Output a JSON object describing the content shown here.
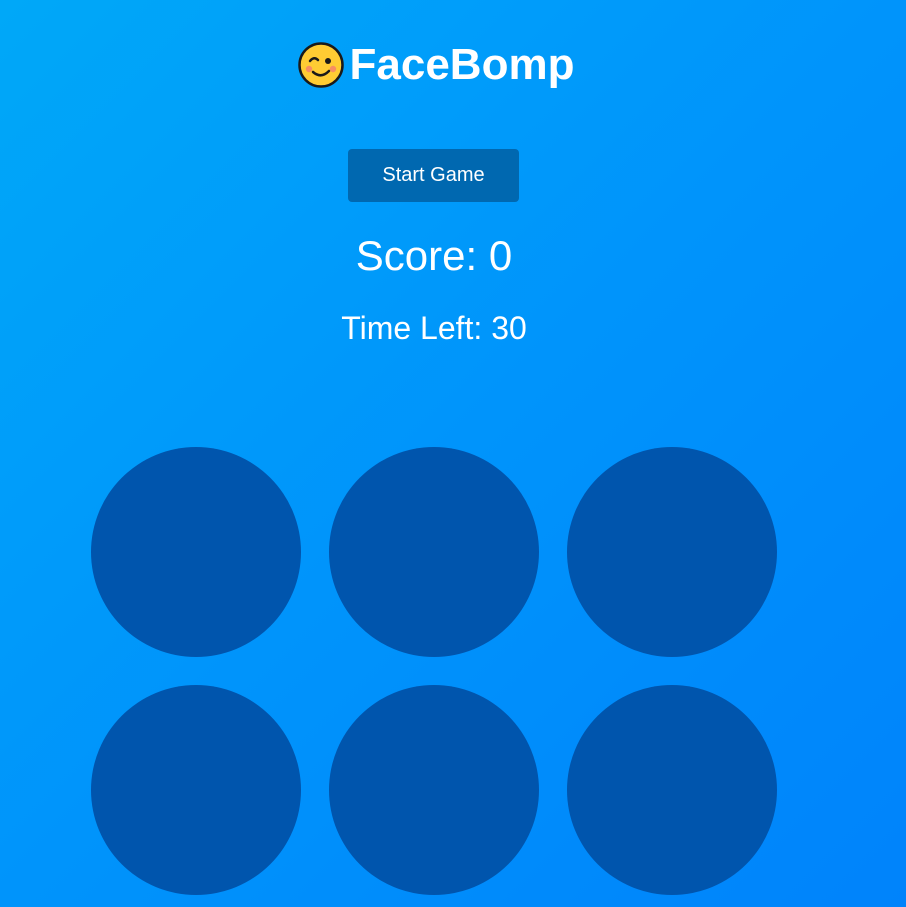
{
  "header": {
    "title": "FaceBomp",
    "emoji_icon": "winking-face-icon"
  },
  "controls": {
    "start_label": "Start Game"
  },
  "status": {
    "score_text": "Score: 0",
    "time_text": "Time Left: 30"
  },
  "board": {
    "hole_count": 6,
    "hole_color": "#0055ad"
  },
  "colors": {
    "background_start": "#00a8f8",
    "background_end": "#0083fb",
    "button": "#0068b0",
    "text": "#ffffff"
  }
}
